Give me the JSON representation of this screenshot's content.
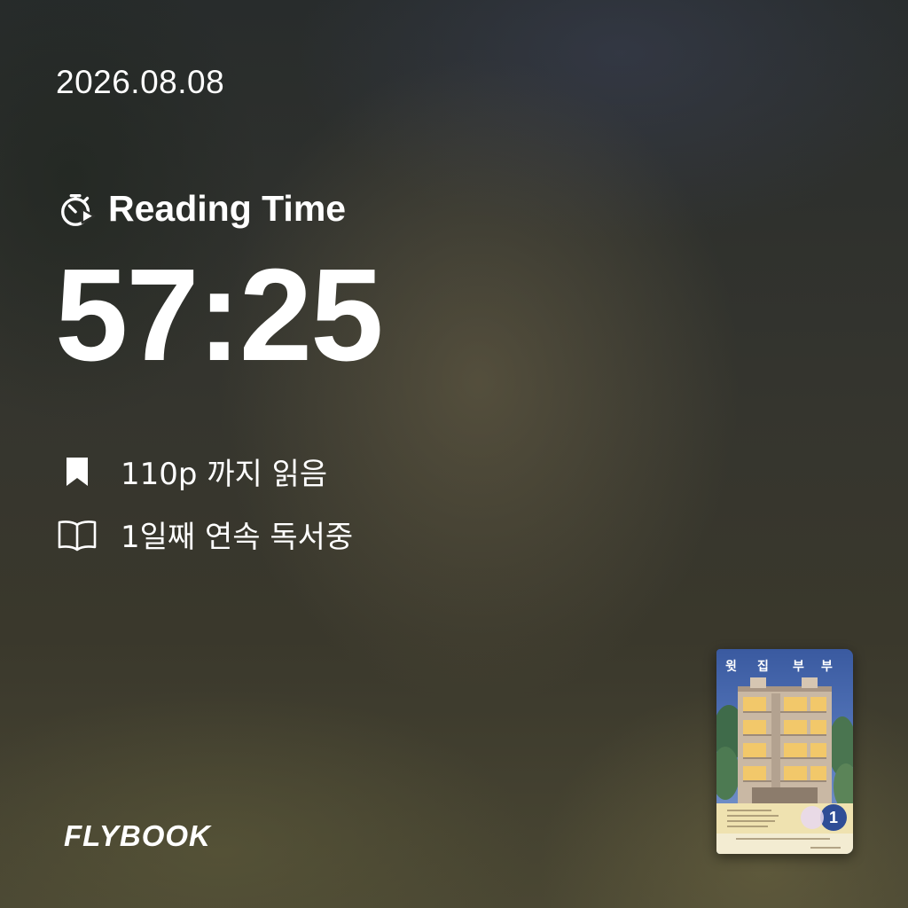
{
  "date": "2026.08.08",
  "reading_time": {
    "icon": "stopwatch-play-icon",
    "label": "Reading Time",
    "value": "57:25"
  },
  "stats": [
    {
      "icon": "bookmark-icon",
      "text": "110p 까지 읽음"
    },
    {
      "icon": "open-book-icon",
      "text": "1일째 연속 독서중"
    }
  ],
  "brand": {
    "logo_text": "FLYBOOK"
  },
  "book": {
    "title_chars": [
      "윗",
      "집",
      "부",
      "부"
    ],
    "badge_number": "1"
  }
}
